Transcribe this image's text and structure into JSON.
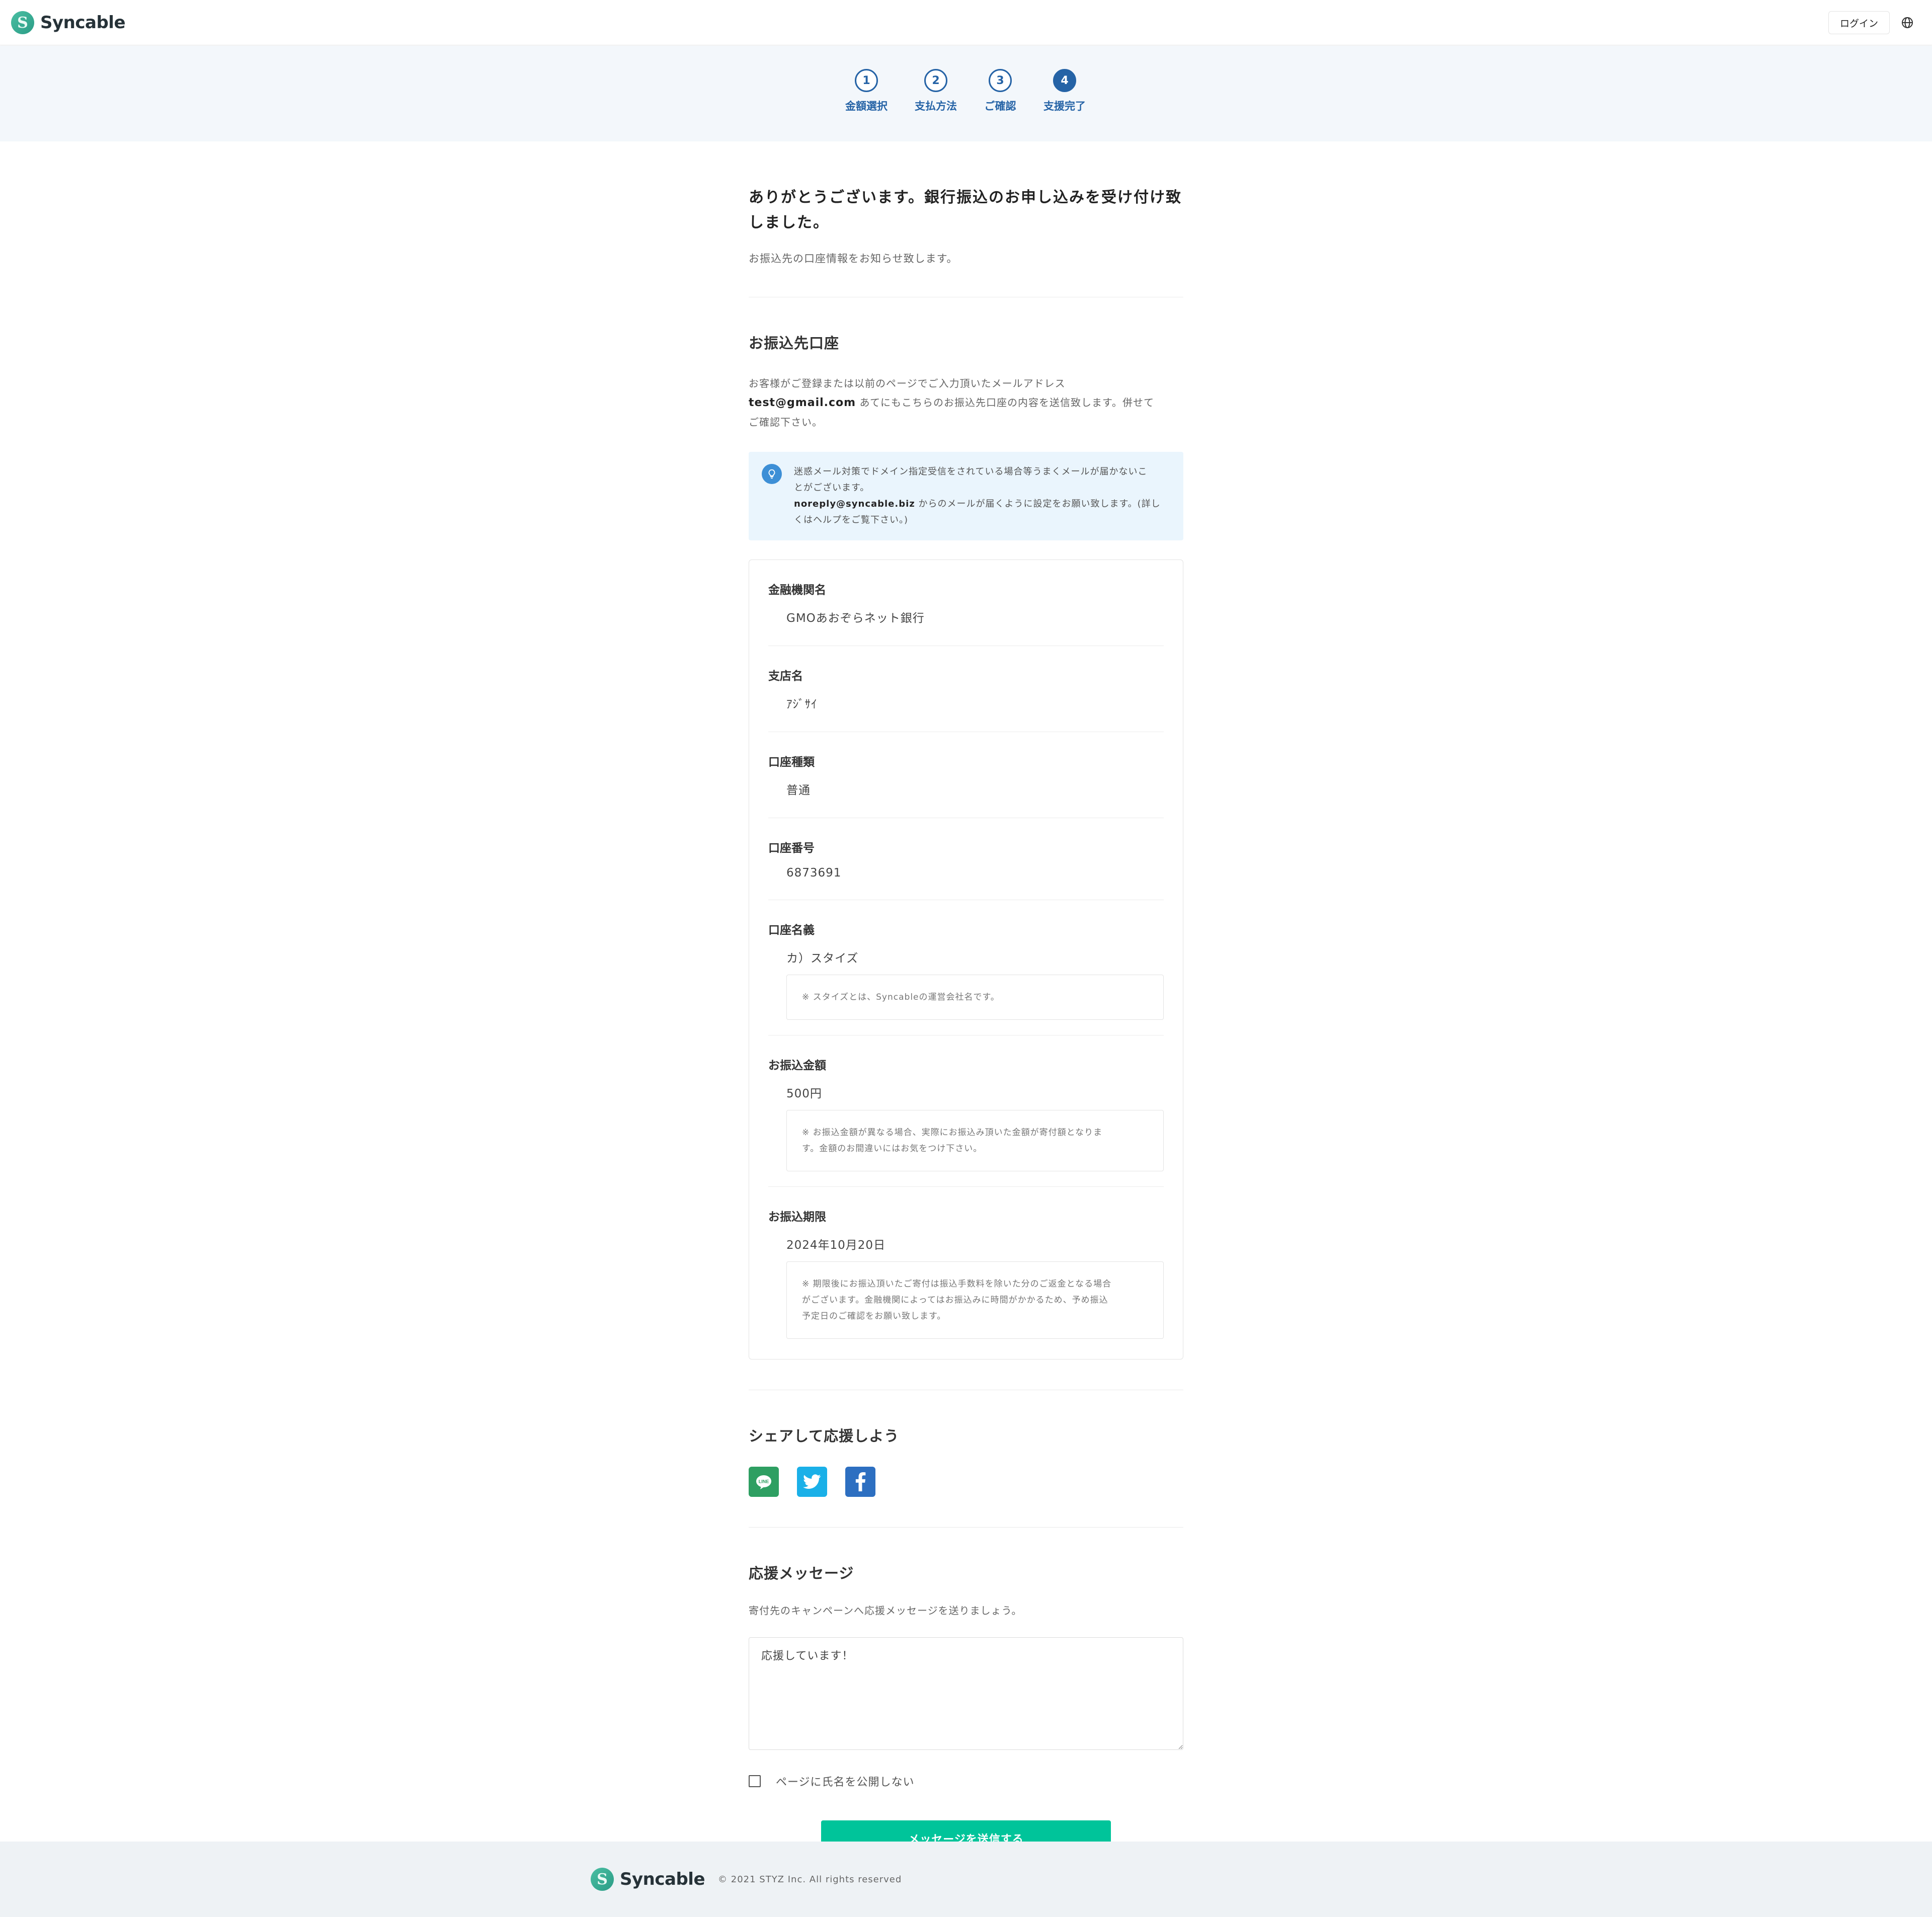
{
  "header": {
    "brand": "Syncable",
    "login_label": "ログイン"
  },
  "steps": [
    {
      "number": "1",
      "label": "金額選択",
      "active": false
    },
    {
      "number": "2",
      "label": "支払方法",
      "active": false
    },
    {
      "number": "3",
      "label": "ご確認",
      "active": false
    },
    {
      "number": "4",
      "label": "支援完了",
      "active": true
    }
  ],
  "thanks": {
    "title_line1": "ありがとうございます。銀行振込のお申し込みを受け付け致",
    "title_line2": "しました。",
    "subtitle": "お振込先の口座情報をお知らせ致します。"
  },
  "transfer": {
    "section_title": "お振込先口座",
    "desc_line1": "お客様がご登録または以前のページでご入力頂いたメールアドレス",
    "email": "test@gmail.com",
    "desc_line2": " あてにもこちらのお振込先口座の内容を送信致します。併せて",
    "desc_line3": "ご確認下さい。",
    "notice_line1": "迷惑メール対策でドメイン指定受信をされている場合等うまくメールが届かないこ",
    "notice_line2": "とがございます。",
    "notice_email": "noreply@syncable.biz",
    "notice_line3": " からのメールが届くように設定をお願い致します。(詳し",
    "notice_line4": "くはヘルプをご覧下さい。)"
  },
  "account": {
    "bank_label": "金融機関名",
    "bank_value": "GMOあおぞらネット銀行",
    "branch_label": "支店名",
    "branch_value": "ｱｼﾞｻｲ",
    "type_label": "口座種類",
    "type_value": "普通",
    "number_label": "口座番号",
    "number_value": "6873691",
    "holder_label": "口座名義",
    "holder_value": "カ）スタイズ",
    "holder_note": "※ スタイズとは、Syncableの運営会社名です。",
    "amount_label": "お振込金額",
    "amount_value": "500円",
    "amount_note_line1": "※ お振込金額が異なる場合、実際にお振込み頂いた金額が寄付額となりま",
    "amount_note_line2": "す。金額のお間違いにはお気をつけ下さい。",
    "deadline_label": "お振込期限",
    "deadline_value": "2024年10月20日",
    "deadline_note_line1": "※ 期限後にお振込頂いたご寄付は振込手数料を除いた分のご返金となる場合",
    "deadline_note_line2": "がございます。金融機関によってはお振込みに時間がかかるため、予め振込",
    "deadline_note_line3": "予定日のご確認をお願い致します。"
  },
  "share": {
    "section_title": "シェアして応援しよう",
    "line_label": "LINE",
    "colors": {
      "line": "#2e9f62",
      "twitter": "#1ab0e8",
      "facebook": "#2d6fc1"
    }
  },
  "message": {
    "section_title": "応援メッセージ",
    "desc": "寄付先のキャンペーンへ応援メッセージを送りましょう。",
    "textarea_value": "応援しています！",
    "checkbox_label": "ページに氏名を公開しない",
    "submit_label": "メッセージを送信する"
  },
  "footer": {
    "brand": "Syncable",
    "copyright": "© 2021 STYZ Inc. All rights reserved"
  },
  "colors": {
    "accent": "#2563a6",
    "submit": "#00c49a",
    "brand_green": "#2a9c86",
    "notice_bg": "#eaf5fd"
  }
}
